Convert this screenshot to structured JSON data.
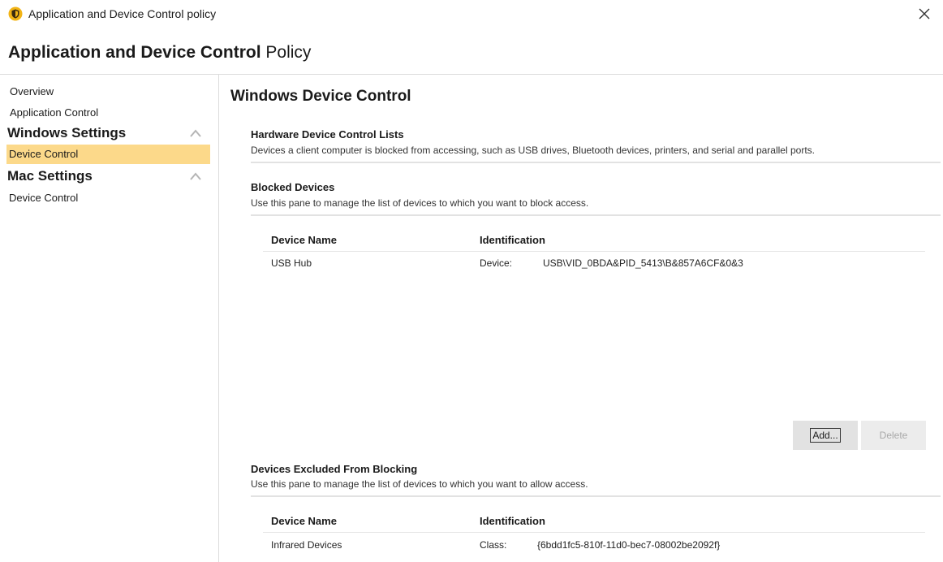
{
  "window": {
    "title": "Application and Device Control policy",
    "close_label": "×"
  },
  "header": {
    "title_bold": "Application and Device Control",
    "title_rest": " Policy"
  },
  "sidebar": {
    "overview": "Overview",
    "application_control": "Application Control",
    "windows_group": "Windows Settings",
    "windows_device_control": "Device Control",
    "mac_group": "Mac Settings",
    "mac_device_control": "Device Control"
  },
  "main": {
    "title": "Windows Device Control",
    "hardware": {
      "title": "Hardware Device Control Lists",
      "description": "Devices a client computer is blocked from accessing, such as USB drives, Bluetooth devices, printers, and serial and parallel ports."
    },
    "blocked": {
      "title": "Blocked Devices",
      "description": "Use this pane to manage the list of devices to which you want to block access.",
      "columns": [
        "Device Name",
        "Identification"
      ],
      "rows": [
        {
          "name": "USB Hub",
          "id_type": "Device:",
          "id_value": "USB\\VID_0BDA&PID_5413\\B&857A6CF&0&3"
        }
      ],
      "add_label": "Add...",
      "delete_label": "Delete"
    },
    "excluded": {
      "title": "Devices Excluded From Blocking",
      "description": "Use this pane to manage the list of devices to which you want to allow access.",
      "columns": [
        "Device Name",
        "Identification"
      ],
      "rows": [
        {
          "name": "Infrared Devices",
          "id_type": "Class:",
          "id_value": "{6bdd1fc5-810f-11d0-bec7-08002be2092f}"
        }
      ]
    }
  },
  "colors": {
    "selected_background": "#fcd98a",
    "accent_icon": "#f2b416"
  }
}
